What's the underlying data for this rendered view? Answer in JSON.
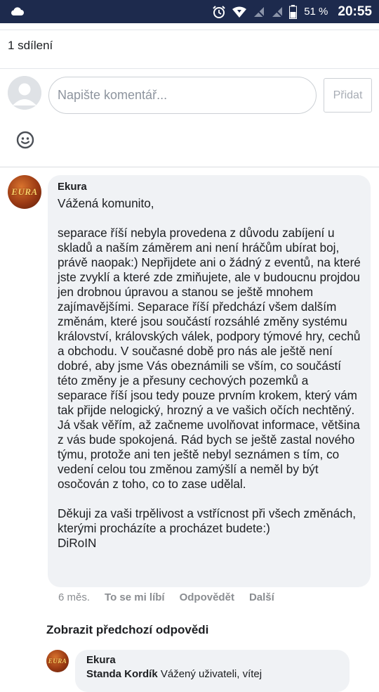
{
  "status_bar": {
    "battery_percent": "51 %",
    "time": "20:55",
    "icons": [
      "cloud-icon",
      "alarm-icon",
      "wifi-icon",
      "no-sim-icon",
      "no-sim-icon",
      "battery-icon"
    ]
  },
  "post": {
    "shares": "1 sdílení"
  },
  "composer": {
    "placeholder": "Napište komentář...",
    "submit_label": "Přidat",
    "emoji_icon": "smiley-icon"
  },
  "comment": {
    "author": "Ekura",
    "avatar_text": "EURA",
    "text": "Vážená komunito,\n\nseparace říší nebyla provedena z důvodu zabíjení u skladů a naším záměrem ani není hráčům ubírat boj, právě naopak:) Nepřijdete ani o žádný z eventů, na které jste zvyklí a které zde zmiňujete, ale v budoucnu projdou jen drobnou úpravou a stanou se ještě mnohem zajímavějšími. Separace říší předchází všem dalším změnám, které jsou součástí rozsáhlé změny systému království, královských válek, podpory týmové hry, cechů a obchodu. V současné době pro nás ale ještě není dobré, aby jsme Vás obeznámili se vším, co součástí této změny je a přesuny cechových pozemků a separace říší jsou tedy pouze prvním krokem, který vám tak přijde nelogický, hrozný a ve vašich očích nechtěný. Já však věřím, až začneme uvolňovat informace, většina z vás bude spokojená. Rád bych se ještě zastal nového týmu, protože ani ten ještě nebyl seznámen s tím, co vedení celou tou změnou zamýšlí a neměl by být osočován z toho, co to zase udělal.\n\nDěkuji za vaši trpělivost a vstřícnost při všech změnách, kterými procházíte a procházet budete:)\nDiRoIN",
    "time_ago": "6 měs.",
    "actions": {
      "like": "To se mi líbí",
      "reply": "Odpovědět",
      "more": "Další"
    }
  },
  "replies": {
    "show_previous": "Zobrazit předchozí odpovědi",
    "last_reply": {
      "author": "Ekura",
      "mention": "Standa Kordík",
      "text_start": "Vážený uživateli, vítej"
    }
  }
}
